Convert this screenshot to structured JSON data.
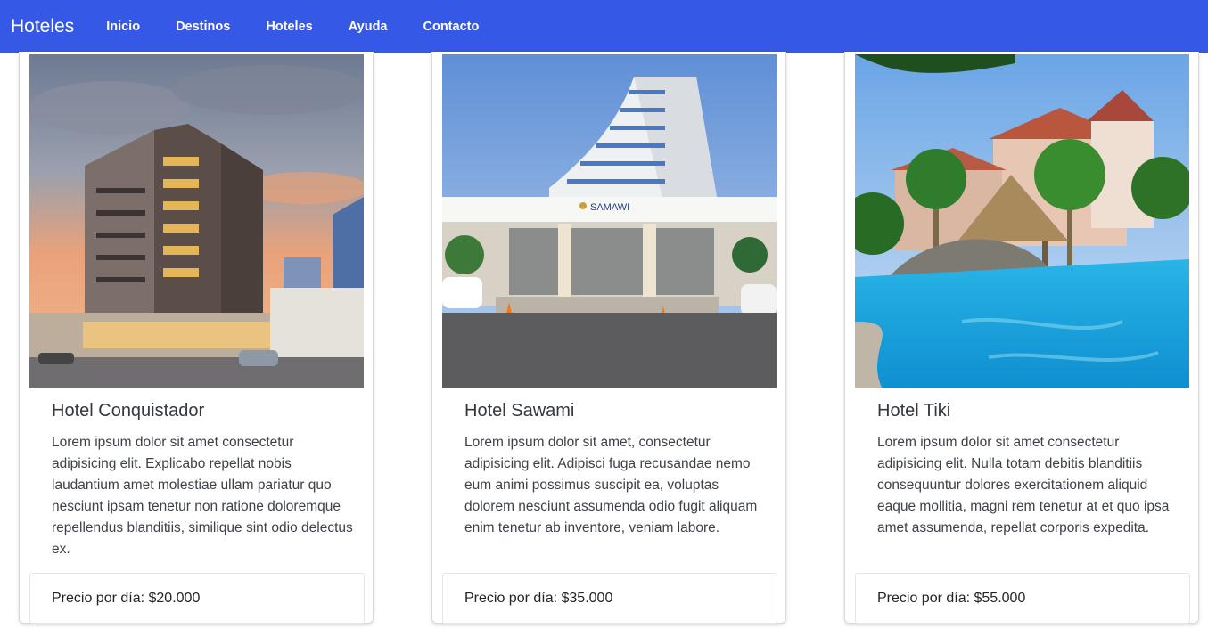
{
  "navbar": {
    "brand": "Hoteles",
    "links": [
      "Inicio",
      "Destinos",
      "Hoteles",
      "Ayuda",
      "Contacto"
    ],
    "background": "#3558e6"
  },
  "hotels": [
    {
      "title": "Hotel Conquistador",
      "description": "Lorem ipsum dolor sit amet consectetur adipisicing elit. Explicabo repellat nobis laudantium amet molestiae ullam pariatur quo nesciunt ipsam tenetur non ratione doloremque repellendus blanditiis, similique sint odio delectus ex.",
      "price": "Precio por día: $20.000",
      "image": "hotel-building-sunset-photo"
    },
    {
      "title": "Hotel Sawami",
      "description": "Lorem ipsum dolor sit amet, consectetur adipisicing elit. Adipisci fuga recusandae nemo eum animi possimus suscipit ea, voluptas dolorem nesciunt assumenda odio fugit aliquam enim tenetur ab inventore, veniam labore.",
      "price": "Precio por día: $35.000",
      "image": "hotel-tower-photo",
      "sign_text": "SAMAWI"
    },
    {
      "title": "Hotel Tiki",
      "description": "Lorem ipsum dolor sit amet consectetur adipisicing elit. Nulla totam debitis blanditiis consequuntur dolores exercitationem aliquid eaque mollitia, magni rem tenetur at et quo ipsa amet assumenda, repellat corporis expedita.",
      "price": "Precio por día: $55.000",
      "image": "resort-pool-photo"
    }
  ]
}
